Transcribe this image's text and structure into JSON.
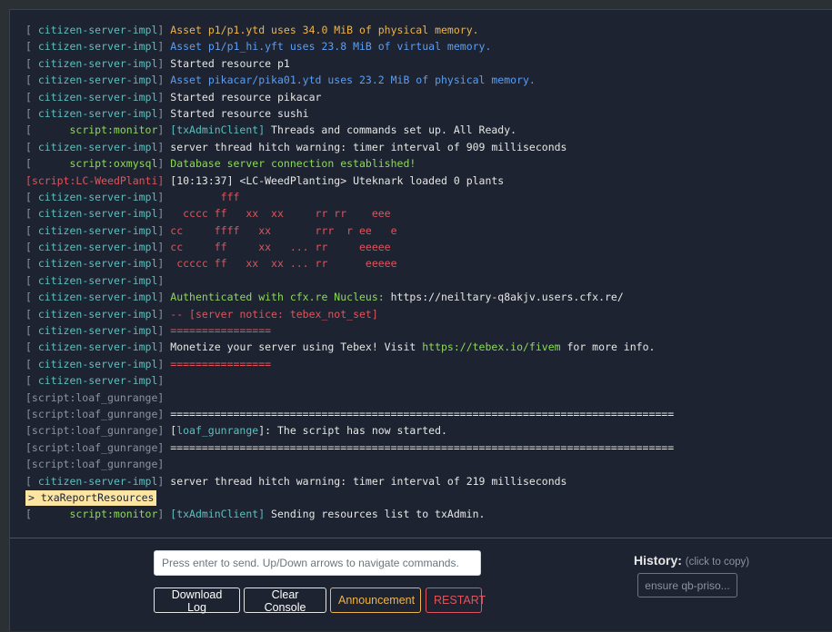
{
  "colors": {
    "background": "#1d2330",
    "default_text": "#e6e6e6",
    "gray": "#8a93a3",
    "teal": "#5ebfbf",
    "green": "#8cd95a",
    "blue": "#5a9ef5",
    "orange": "#f0b44a",
    "red": "#e0545c",
    "cmd_bg": "#fce4a3"
  },
  "console": {
    "lines": [
      [
        [
          "[ ",
          "gray"
        ],
        [
          "citizen-server-impl",
          "teal"
        ],
        [
          "] ",
          "gray"
        ],
        [
          "Asset p1/p1.ytd uses 34.0 MiB of physical memory.",
          "orange"
        ]
      ],
      [
        [
          "[ ",
          "gray"
        ],
        [
          "citizen-server-impl",
          "teal"
        ],
        [
          "] ",
          "gray"
        ],
        [
          "Asset p1/p1_hi.yft uses 23.8 MiB of virtual memory.",
          "blue"
        ]
      ],
      [
        [
          "[ ",
          "gray"
        ],
        [
          "citizen-server-impl",
          "teal"
        ],
        [
          "] ",
          "gray"
        ],
        [
          "Started resource p1",
          "default_text"
        ]
      ],
      [
        [
          "[ ",
          "gray"
        ],
        [
          "citizen-server-impl",
          "teal"
        ],
        [
          "] ",
          "gray"
        ],
        [
          "Asset pikacar/pika01.ytd uses 23.2 MiB of physical memory.",
          "blue"
        ]
      ],
      [
        [
          "[ ",
          "gray"
        ],
        [
          "citizen-server-impl",
          "teal"
        ],
        [
          "] ",
          "gray"
        ],
        [
          "Started resource pikacar",
          "default_text"
        ]
      ],
      [
        [
          "[ ",
          "gray"
        ],
        [
          "citizen-server-impl",
          "teal"
        ],
        [
          "] ",
          "gray"
        ],
        [
          "Started resource sushi",
          "default_text"
        ]
      ],
      [
        [
          "[      ",
          "gray"
        ],
        [
          "script:monitor",
          "green"
        ],
        [
          "] ",
          "gray"
        ],
        [
          "[txAdminClient]",
          "teal"
        ],
        [
          " Threads and commands set up. All Ready.",
          "default_text"
        ]
      ],
      [
        [
          "[ ",
          "gray"
        ],
        [
          "citizen-server-impl",
          "teal"
        ],
        [
          "] ",
          "gray"
        ],
        [
          "server thread hitch warning: timer interval of 909 milliseconds",
          "default_text"
        ]
      ],
      [
        [
          "[      ",
          "gray"
        ],
        [
          "script:oxmysql",
          "green"
        ],
        [
          "] ",
          "gray"
        ],
        [
          "Database server connection established!",
          "green"
        ]
      ],
      [
        [
          "[",
          "red"
        ],
        [
          "script:LC-WeedPlanti",
          "red"
        ],
        [
          "] ",
          "red"
        ],
        [
          "[10:13:37] <LC-WeedPlanting> Uteknark loaded 0 plants",
          "default_text"
        ]
      ],
      [
        [
          "[ ",
          "gray"
        ],
        [
          "citizen-server-impl",
          "teal"
        ],
        [
          "] ",
          "gray"
        ],
        [
          "        fff",
          "red"
        ]
      ],
      [
        [
          "[ ",
          "gray"
        ],
        [
          "citizen-server-impl",
          "teal"
        ],
        [
          "] ",
          "gray"
        ],
        [
          "  cccc ff   xx  xx     rr rr    eee",
          "red"
        ]
      ],
      [
        [
          "[ ",
          "gray"
        ],
        [
          "citizen-server-impl",
          "teal"
        ],
        [
          "] ",
          "gray"
        ],
        [
          "cc     ffff   xx       rrr  r ee   e",
          "red"
        ]
      ],
      [
        [
          "[ ",
          "gray"
        ],
        [
          "citizen-server-impl",
          "teal"
        ],
        [
          "] ",
          "gray"
        ],
        [
          "cc     ff     xx   ... rr     eeeee",
          "red"
        ]
      ],
      [
        [
          "[ ",
          "gray"
        ],
        [
          "citizen-server-impl",
          "teal"
        ],
        [
          "] ",
          "gray"
        ],
        [
          " ccccc ff   xx  xx ... rr      eeeee",
          "red"
        ]
      ],
      [
        [
          "[ ",
          "gray"
        ],
        [
          "citizen-server-impl",
          "teal"
        ],
        [
          "] ",
          "gray"
        ]
      ],
      [
        [
          "[ ",
          "gray"
        ],
        [
          "citizen-server-impl",
          "teal"
        ],
        [
          "] ",
          "gray"
        ],
        [
          "Authenticated with cfx.re Nucleus: ",
          "green"
        ],
        [
          "https://neiltary-q8akjv.users.cfx.re/",
          "default_text"
        ]
      ],
      [
        [
          "[ ",
          "gray"
        ],
        [
          "citizen-server-impl",
          "teal"
        ],
        [
          "] ",
          "gray"
        ],
        [
          "-- [server notice: tebex_not_set]",
          "red"
        ]
      ],
      [
        [
          "[ ",
          "gray"
        ],
        [
          "citizen-server-impl",
          "teal"
        ],
        [
          "] ",
          "gray"
        ],
        [
          "================",
          "red"
        ]
      ],
      [
        [
          "[ ",
          "gray"
        ],
        [
          "citizen-server-impl",
          "teal"
        ],
        [
          "] ",
          "gray"
        ],
        [
          "Monetize your server using Tebex! Visit ",
          "default_text"
        ],
        [
          "https://tebex.io/fivem",
          "green"
        ],
        [
          " for more info.",
          "default_text"
        ]
      ],
      [
        [
          "[ ",
          "gray"
        ],
        [
          "citizen-server-impl",
          "teal"
        ],
        [
          "] ",
          "gray"
        ],
        [
          "================",
          "red"
        ]
      ],
      [
        [
          "[ ",
          "gray"
        ],
        [
          "citizen-server-impl",
          "teal"
        ],
        [
          "] ",
          "gray"
        ]
      ],
      [
        [
          "[script:loaf_gunrange]",
          "gray"
        ]
      ],
      [
        [
          "[script:loaf_gunrange]",
          "gray"
        ],
        [
          " ================================================================================",
          "default_text"
        ]
      ],
      [
        [
          "[script:loaf_gunrange]",
          "gray"
        ],
        [
          " [",
          "default_text"
        ],
        [
          "loaf_gunrange",
          "teal"
        ],
        [
          "]: The script has now started.",
          "default_text"
        ]
      ],
      [
        [
          "[script:loaf_gunrange]",
          "gray"
        ],
        [
          " ================================================================================",
          "default_text"
        ]
      ],
      [
        [
          "[script:loaf_gunrange]",
          "gray"
        ]
      ],
      [
        [
          "[ ",
          "gray"
        ],
        [
          "citizen-server-impl",
          "teal"
        ],
        [
          "] ",
          "gray"
        ],
        [
          "server thread hitch warning: timer interval of 219 milliseconds",
          "default_text"
        ]
      ],
      "CMD",
      [
        [
          "[      ",
          "gray"
        ],
        [
          "script:monitor",
          "green"
        ],
        [
          "] ",
          "gray"
        ],
        [
          "[txAdminClient]",
          "teal"
        ],
        [
          " Sending resources list to txAdmin.",
          "default_text"
        ]
      ]
    ],
    "last_command": "> txaReportResources"
  },
  "command_input": {
    "placeholder": "Press enter to send. Up/Down arrows to navigate commands.",
    "value": ""
  },
  "buttons": {
    "download_log": "Download Log",
    "clear_console": "Clear Console",
    "announcement": "Announcement",
    "restart": "RESTART"
  },
  "history": {
    "title": "History:",
    "note": "(click to copy)",
    "entries": [
      "ensure qb-priso..."
    ]
  }
}
